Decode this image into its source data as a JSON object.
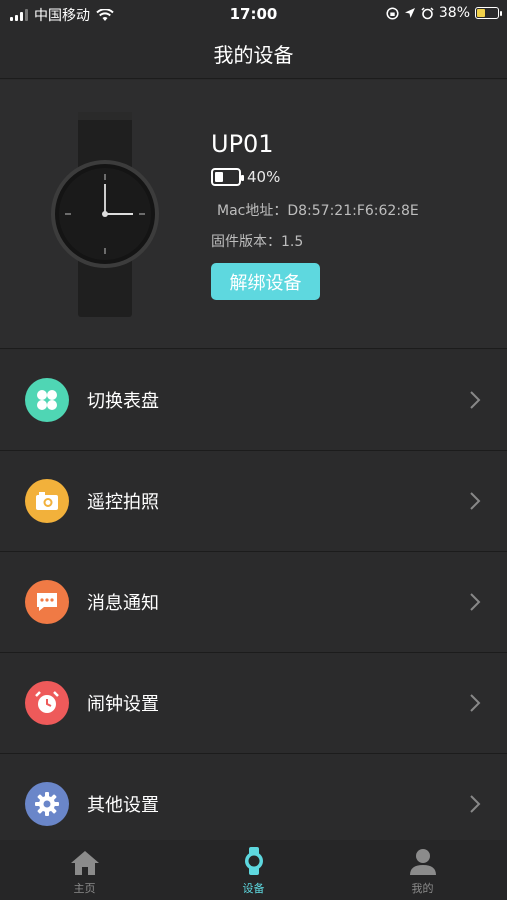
{
  "status": {
    "carrier": "中国移动",
    "time": "17:00",
    "battery_pct": "38%"
  },
  "nav": {
    "title": "我的设备"
  },
  "device": {
    "name": "UP01",
    "battery": "40%",
    "mac": "Mac地址：D8:57:21:F6:62:8E",
    "firmware": "固件版本：1.5",
    "unbind_label": "解绑设备"
  },
  "menu": {
    "items": [
      {
        "label": "切换表盘",
        "icon": "watchface-icon",
        "color": "#4fd6b4"
      },
      {
        "label": "遥控拍照",
        "icon": "camera-icon",
        "color": "#f2b13b"
      },
      {
        "label": "消息通知",
        "icon": "message-icon",
        "color": "#f07a45"
      },
      {
        "label": "闹钟设置",
        "icon": "alarm-icon",
        "color": "#ee5a5a"
      },
      {
        "label": "其他设置",
        "icon": "gear-icon",
        "color": "#6a86c9"
      }
    ]
  },
  "tabs": [
    {
      "label": "主页",
      "icon": "home-icon"
    },
    {
      "label": "设备",
      "icon": "watch-icon",
      "active": true
    },
    {
      "label": "我的",
      "icon": "person-icon"
    }
  ],
  "colors": {
    "accent": "#5ed8df",
    "background": "#2a2a2b"
  }
}
